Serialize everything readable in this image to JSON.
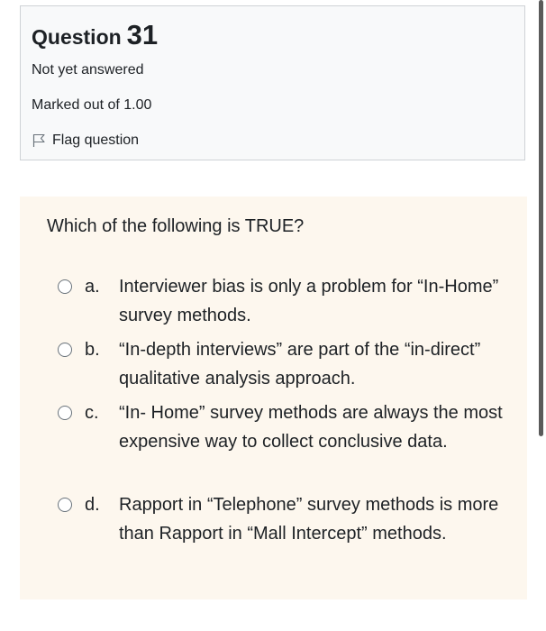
{
  "info": {
    "question_label": "Question",
    "question_number": "31",
    "state": "Not yet answered",
    "grade": "Marked out of 1.00",
    "flag_label": "Flag question"
  },
  "question": {
    "text": "Which of the following is TRUE?",
    "options": [
      {
        "letter": "a.",
        "text": "Interviewer bias is only a problem for “In-Home” survey methods."
      },
      {
        "letter": "b.",
        "text": "“In-depth interviews” are part of the “in-direct” qualitative analysis approach."
      },
      {
        "letter": "c.",
        "text": "“In- Home” survey methods are always the most expensive way to collect conclusive data."
      },
      {
        "letter": "d.",
        "text": "Rapport in “Telephone” survey methods is more than Rapport in “Mall Intercept” methods."
      }
    ]
  },
  "colors": {
    "info_background": "#f8f9fa",
    "formulation_background": "#fdf7ee",
    "text": "#1d2125"
  }
}
